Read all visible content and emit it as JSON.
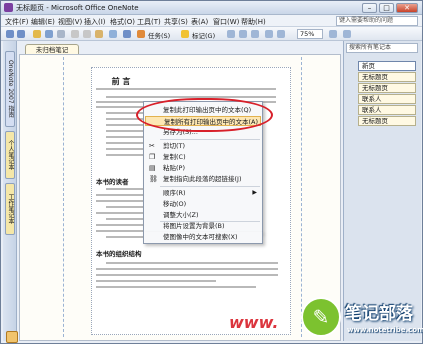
{
  "window": {
    "title": "无标题页 - Microsoft Office OneNote"
  },
  "menubar": {
    "items": [
      "文件(F)",
      "编辑(E)",
      "视图(V)",
      "插入(I)",
      "格式(O)",
      "工具(T)",
      "共享(S)",
      "表(A)",
      "窗口(W)",
      "帮助(H)"
    ],
    "help_placeholder": "键入需要帮助的问题"
  },
  "toolbar": {
    "task_label": "任务(S)",
    "tag_label": "标记(G)",
    "zoom": "75%"
  },
  "notebook_pane": {
    "tabs": [
      "OneNote 2007 指南",
      "个人笔记本",
      "工作笔记本"
    ]
  },
  "section_tab": "未归档笔记",
  "search": {
    "placeholder": "搜索所有笔记本"
  },
  "page_tabs": [
    "新页",
    "无标题页",
    "无标题页",
    "联系人",
    "联系人",
    "无标题页"
  ],
  "document": {
    "title": "前 言",
    "heading_1": "本书的读者",
    "heading_2": "本书的组织结构"
  },
  "context_menu": {
    "items": [
      "复制此打印输出页中的文本(Q)",
      "复制所有打印输出页中的文本(A)",
      "另存为(S)...",
      "剪切(T)",
      "复制(C)",
      "粘贴(P)",
      "复制指向此段落的超链接(J)",
      "顺序(R)",
      "移动(O)",
      "调整大小(Z)",
      "将图片设置为背景(B)",
      "使图像中的文本可搜索(X)"
    ]
  },
  "watermark": {
    "title": "笔记部落",
    "url": "www.notetribe.com",
    "www": "www."
  }
}
